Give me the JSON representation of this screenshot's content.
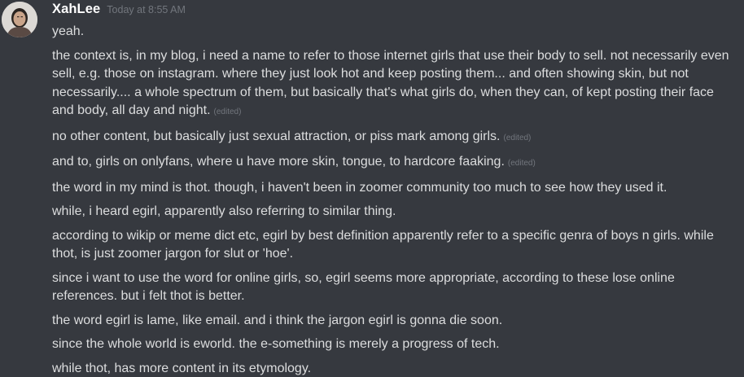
{
  "user": {
    "name": "XahLee",
    "timestamp": "Today at 8:55 AM",
    "avatar_icon": "user-photo-avatar"
  },
  "messages": [
    {
      "text": "yeah.",
      "edited": ""
    },
    {
      "text": "the context is, in my blog, i need a name to refer to those internet girls that use their body to sell. not necessarily even sell, e.g. those on instagram. where they just look hot and keep posting them... and often showing skin, but not necessarily.... a whole spectrum of them, but basically that's what girls do, when they can, of kept posting their face and body, all day and night.",
      "edited": "(edited)"
    },
    {
      "text": "no other content, but basically just sexual attraction, or piss mark among girls.",
      "edited": "(edited)"
    },
    {
      "text": "and to, girls on onlyfans, where u have more skin, tongue, to hardcore faaking.",
      "edited": "(edited)"
    },
    {
      "text": "the word in my mind is thot. though, i haven't been in zoomer community too much to see how they used it.",
      "edited": ""
    },
    {
      "text": "while, i heard egirl, apparently also referring to similar thing.",
      "edited": ""
    },
    {
      "text": "according to wikip or meme dict etc, egirl by best definition apparently refer to a specific genra of boys n girls. while thot, is just zoomer jargon for slut or 'hoe'.",
      "edited": ""
    },
    {
      "text": "since i want to use the word for online girls, so, egirl seems more appropriate, according to these lose online references. but i felt thot is better.",
      "edited": ""
    },
    {
      "text": "the word egirl is lame, like email. and i think the jargon egirl is gonna die soon.",
      "edited": ""
    },
    {
      "text": "since the whole world is eworld. the e-something is merely a progress of tech.",
      "edited": ""
    },
    {
      "text": "while thot, has more content in its etymology.",
      "edited": ""
    }
  ],
  "colors": {
    "background": "#36393f",
    "text": "#dcddde",
    "username": "#ffffff",
    "muted": "#72767d"
  }
}
